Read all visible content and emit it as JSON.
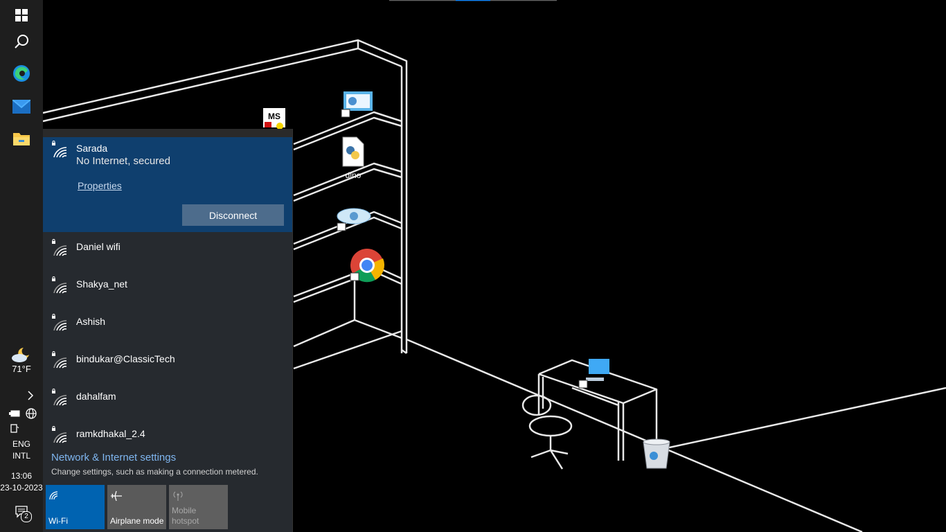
{
  "taskbar": {
    "buttons": [
      "start",
      "search",
      "edge",
      "mail",
      "file-explorer"
    ],
    "weather": {
      "temp": "71°F"
    },
    "language": {
      "line1": "ENG",
      "line2": "INTL"
    },
    "clock": {
      "time": "13:06",
      "date": "23-10-2023"
    },
    "notifications_count": "2"
  },
  "desktop": {
    "icons": [
      {
        "name": "ms-app-shortcut",
        "label": ""
      },
      {
        "name": "control-panel-shortcut",
        "label": ""
      },
      {
        "name": "python-file",
        "label": "dino"
      },
      {
        "name": "eye-app-shortcut",
        "label": ""
      },
      {
        "name": "chrome-shortcut",
        "label": ""
      },
      {
        "name": "this-pc-shortcut",
        "label": ""
      },
      {
        "name": "recycle-bin",
        "label": ""
      }
    ]
  },
  "network_flyout": {
    "connected": {
      "name": "Sarada",
      "status": "No Internet, secured",
      "properties_label": "Properties",
      "disconnect_label": "Disconnect"
    },
    "networks": [
      "Daniel wifi",
      "Shakya_net",
      "Ashish",
      "bindukar@ClassicTech",
      "dahalfam",
      "ramkdhakal_2.4"
    ],
    "settings_link": "Network & Internet settings",
    "settings_desc": "Change settings, such as making a connection metered.",
    "tiles": {
      "wifi": "Wi-Fi",
      "airplane": "Airplane mode",
      "hotspot_line1": "Mobile",
      "hotspot_line2": "hotspot"
    }
  },
  "colors": {
    "accent": "#0063b1",
    "connected_bg": "#0f3f6e",
    "flyout_bg": "#262a2f",
    "taskbar_bg": "#1e1e1e"
  }
}
